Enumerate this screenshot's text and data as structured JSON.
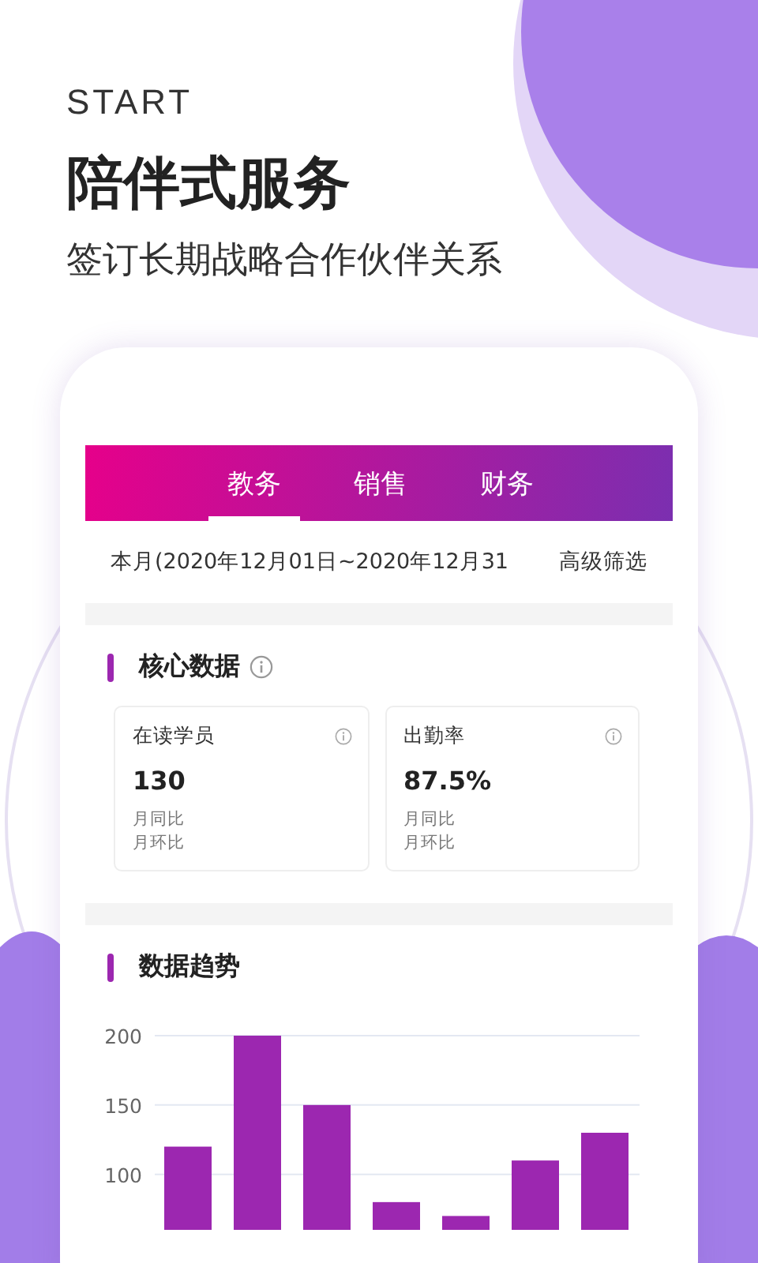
{
  "header": {
    "eyebrow": "START",
    "title": "陪伴式服务",
    "subtitle": "签订长期战略合作伙伴关系"
  },
  "tabs": [
    {
      "label": "教务",
      "selected": true
    },
    {
      "label": "销售",
      "selected": false
    },
    {
      "label": "财务",
      "selected": false
    }
  ],
  "date_range": "本月(2020年12月01日~2020年12月31",
  "filter_button": "高级筛选",
  "core_section": {
    "title": "核心数据",
    "cards": [
      {
        "label": "在读学员",
        "value": "130",
        "lines": [
          "月同比",
          "月环比"
        ]
      },
      {
        "label": "出勤率",
        "value": "87.5%",
        "lines": [
          "月同比",
          "月环比"
        ]
      }
    ]
  },
  "trend_section": {
    "title": "数据趋势",
    "chart_data": {
      "type": "bar",
      "values": [
        120,
        200,
        150,
        80,
        70,
        110,
        130
      ],
      "ylim": [
        60,
        200
      ],
      "yticks": [
        100,
        150,
        200
      ]
    }
  }
}
